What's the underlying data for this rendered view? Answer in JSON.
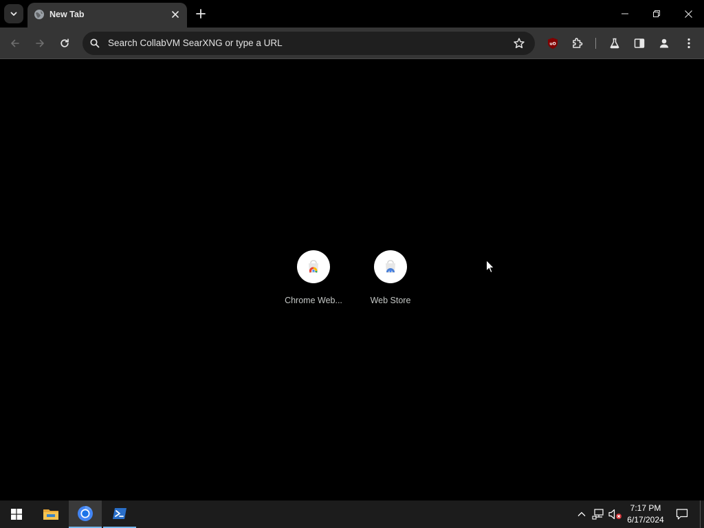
{
  "browser": {
    "tab": {
      "title": "New Tab"
    },
    "omnibox": {
      "placeholder": "Search CollabVM SearXNG or type a URL"
    },
    "extensions": {
      "ublock_label": "uO"
    }
  },
  "shortcuts": [
    {
      "label": "Chrome Web..."
    },
    {
      "label": "Web Store"
    }
  ],
  "taskbar": {
    "clock": {
      "time": "7:17 PM",
      "date": "6/17/2024"
    }
  },
  "colors": {
    "toolbar_bg": "#353535",
    "omnibox_bg": "#1f1f1f",
    "page_bg": "#000000",
    "taskbar_bg": "#1c1c1c",
    "taskbar_accent": "#76b9ed",
    "ublock_red": "#800000"
  }
}
